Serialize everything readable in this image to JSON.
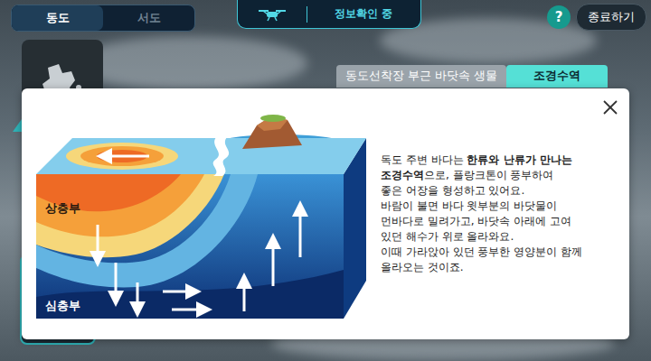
{
  "location_tabs": [
    {
      "label": "동도",
      "selected": true
    },
    {
      "label": "서도",
      "selected": false
    }
  ],
  "status": {
    "label": "정보확인 중"
  },
  "help_button": "?",
  "exit_button": "종료하기",
  "info_tabs": [
    {
      "label": "동도선착장 부근 바닷속 생물",
      "selected": false
    },
    {
      "label": "조경수역",
      "selected": true
    }
  ],
  "diagram": {
    "labels": [
      "상층부",
      "심층부"
    ]
  },
  "description": [
    {
      "segments": [
        {
          "text": "독도 주변 바다는 ",
          "bold": false
        },
        {
          "text": "한류와 난류가 만나는",
          "bold": true
        }
      ]
    },
    {
      "segments": [
        {
          "text": "조경수역",
          "bold": true
        },
        {
          "text": "으로, 플랑크톤이 풍부하여",
          "bold": false
        }
      ]
    },
    {
      "segments": [
        {
          "text": "좋은 어장을 형성하고 있어요.",
          "bold": false
        }
      ]
    },
    {
      "segments": [
        {
          "text": "바람이 불면 바다 윗부분의 바닷물이",
          "bold": false
        }
      ]
    },
    {
      "segments": [
        {
          "text": "먼바다로 밀려가고, 바닷속 아래에 고여",
          "bold": false
        }
      ]
    },
    {
      "segments": [
        {
          "text": "있던 해수가 위로 올라와요.",
          "bold": false
        }
      ]
    },
    {
      "segments": [
        {
          "text": "이때 가라앉아 있던 풍부한 영양분이 함께",
          "bold": false
        }
      ]
    },
    {
      "segments": [
        {
          "text": "올라오는 것이죠.",
          "bold": false
        }
      ]
    }
  ]
}
